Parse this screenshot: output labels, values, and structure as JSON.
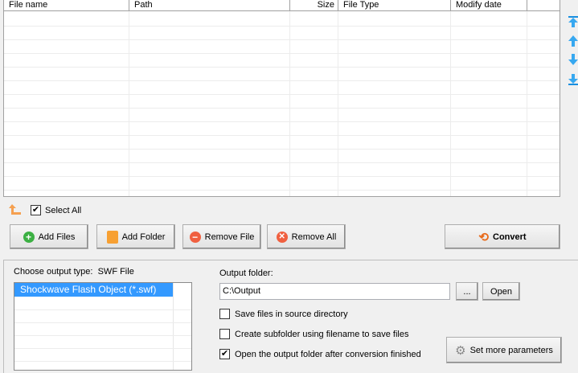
{
  "table": {
    "columns": [
      "File name",
      "Path",
      "Size",
      "File Type",
      "Modify date"
    ]
  },
  "side_buttons": [
    "move-top",
    "move-up",
    "move-down",
    "move-bottom"
  ],
  "select_all": {
    "label": "Select All",
    "checked": true
  },
  "buttons": {
    "add_files": "Add Files",
    "add_folder": "Add Folder",
    "remove_file": "Remove File",
    "remove_all": "Remove All",
    "convert": "Convert"
  },
  "output": {
    "type_label": "Choose output type:",
    "type_value": "SWF File",
    "formats": [
      "Shockwave Flash Object (*.swf)"
    ],
    "folder_label": "Output folder:",
    "folder_value": "C:\\Output",
    "browse": "...",
    "open": "Open"
  },
  "options": [
    {
      "label": "Save files in source directory",
      "checked": false
    },
    {
      "label": "Create subfolder using filename to save files",
      "checked": false
    },
    {
      "label": "Open the output folder after conversion finished",
      "checked": true
    }
  ],
  "more_params": "Set more parameters",
  "colors": {
    "selection": "#3399ff",
    "arrow": "#1a8fe0"
  }
}
